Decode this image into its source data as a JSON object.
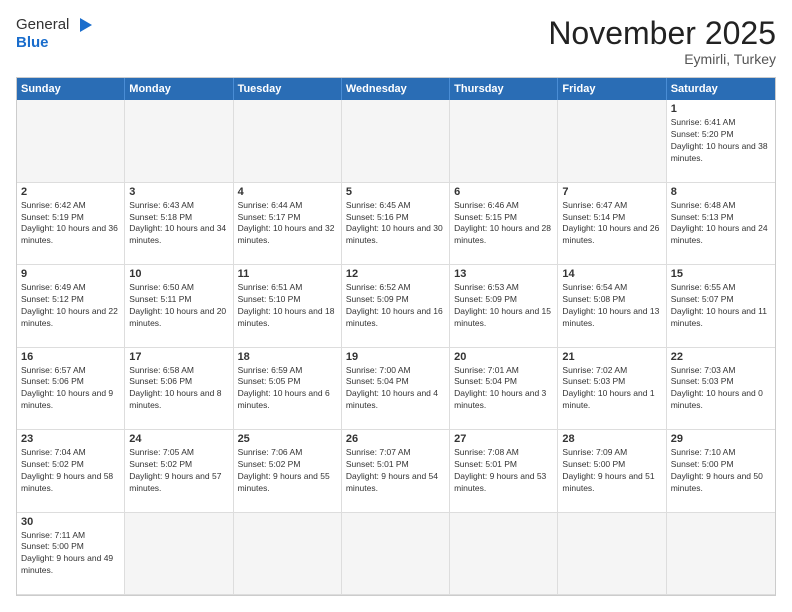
{
  "header": {
    "logo_general": "General",
    "logo_blue": "Blue",
    "month_year": "November 2025",
    "location": "Eymirli, Turkey"
  },
  "days": [
    "Sunday",
    "Monday",
    "Tuesday",
    "Wednesday",
    "Thursday",
    "Friday",
    "Saturday"
  ],
  "cells": [
    {
      "day": "",
      "empty": true,
      "text": ""
    },
    {
      "day": "",
      "empty": true,
      "text": ""
    },
    {
      "day": "",
      "empty": true,
      "text": ""
    },
    {
      "day": "",
      "empty": true,
      "text": ""
    },
    {
      "day": "",
      "empty": true,
      "text": ""
    },
    {
      "day": "",
      "empty": true,
      "text": ""
    },
    {
      "day": "1",
      "text": "Sunrise: 6:41 AM\nSunset: 5:20 PM\nDaylight: 10 hours and 38 minutes."
    },
    {
      "day": "2",
      "text": "Sunrise: 6:42 AM\nSunset: 5:19 PM\nDaylight: 10 hours and 36 minutes."
    },
    {
      "day": "3",
      "text": "Sunrise: 6:43 AM\nSunset: 5:18 PM\nDaylight: 10 hours and 34 minutes."
    },
    {
      "day": "4",
      "text": "Sunrise: 6:44 AM\nSunset: 5:17 PM\nDaylight: 10 hours and 32 minutes."
    },
    {
      "day": "5",
      "text": "Sunrise: 6:45 AM\nSunset: 5:16 PM\nDaylight: 10 hours and 30 minutes."
    },
    {
      "day": "6",
      "text": "Sunrise: 6:46 AM\nSunset: 5:15 PM\nDaylight: 10 hours and 28 minutes."
    },
    {
      "day": "7",
      "text": "Sunrise: 6:47 AM\nSunset: 5:14 PM\nDaylight: 10 hours and 26 minutes."
    },
    {
      "day": "8",
      "text": "Sunrise: 6:48 AM\nSunset: 5:13 PM\nDaylight: 10 hours and 24 minutes."
    },
    {
      "day": "9",
      "text": "Sunrise: 6:49 AM\nSunset: 5:12 PM\nDaylight: 10 hours and 22 minutes."
    },
    {
      "day": "10",
      "text": "Sunrise: 6:50 AM\nSunset: 5:11 PM\nDaylight: 10 hours and 20 minutes."
    },
    {
      "day": "11",
      "text": "Sunrise: 6:51 AM\nSunset: 5:10 PM\nDaylight: 10 hours and 18 minutes."
    },
    {
      "day": "12",
      "text": "Sunrise: 6:52 AM\nSunset: 5:09 PM\nDaylight: 10 hours and 16 minutes."
    },
    {
      "day": "13",
      "text": "Sunrise: 6:53 AM\nSunset: 5:09 PM\nDaylight: 10 hours and 15 minutes."
    },
    {
      "day": "14",
      "text": "Sunrise: 6:54 AM\nSunset: 5:08 PM\nDaylight: 10 hours and 13 minutes."
    },
    {
      "day": "15",
      "text": "Sunrise: 6:55 AM\nSunset: 5:07 PM\nDaylight: 10 hours and 11 minutes."
    },
    {
      "day": "16",
      "text": "Sunrise: 6:57 AM\nSunset: 5:06 PM\nDaylight: 10 hours and 9 minutes."
    },
    {
      "day": "17",
      "text": "Sunrise: 6:58 AM\nSunset: 5:06 PM\nDaylight: 10 hours and 8 minutes."
    },
    {
      "day": "18",
      "text": "Sunrise: 6:59 AM\nSunset: 5:05 PM\nDaylight: 10 hours and 6 minutes."
    },
    {
      "day": "19",
      "text": "Sunrise: 7:00 AM\nSunset: 5:04 PM\nDaylight: 10 hours and 4 minutes."
    },
    {
      "day": "20",
      "text": "Sunrise: 7:01 AM\nSunset: 5:04 PM\nDaylight: 10 hours and 3 minutes."
    },
    {
      "day": "21",
      "text": "Sunrise: 7:02 AM\nSunset: 5:03 PM\nDaylight: 10 hours and 1 minute."
    },
    {
      "day": "22",
      "text": "Sunrise: 7:03 AM\nSunset: 5:03 PM\nDaylight: 10 hours and 0 minutes."
    },
    {
      "day": "23",
      "text": "Sunrise: 7:04 AM\nSunset: 5:02 PM\nDaylight: 9 hours and 58 minutes."
    },
    {
      "day": "24",
      "text": "Sunrise: 7:05 AM\nSunset: 5:02 PM\nDaylight: 9 hours and 57 minutes."
    },
    {
      "day": "25",
      "text": "Sunrise: 7:06 AM\nSunset: 5:02 PM\nDaylight: 9 hours and 55 minutes."
    },
    {
      "day": "26",
      "text": "Sunrise: 7:07 AM\nSunset: 5:01 PM\nDaylight: 9 hours and 54 minutes."
    },
    {
      "day": "27",
      "text": "Sunrise: 7:08 AM\nSunset: 5:01 PM\nDaylight: 9 hours and 53 minutes."
    },
    {
      "day": "28",
      "text": "Sunrise: 7:09 AM\nSunset: 5:00 PM\nDaylight: 9 hours and 51 minutes."
    },
    {
      "day": "29",
      "text": "Sunrise: 7:10 AM\nSunset: 5:00 PM\nDaylight: 9 hours and 50 minutes."
    },
    {
      "day": "30",
      "text": "Sunrise: 7:11 AM\nSunset: 5:00 PM\nDaylight: 9 hours and 49 minutes."
    },
    {
      "day": "",
      "empty": true,
      "text": ""
    },
    {
      "day": "",
      "empty": true,
      "text": ""
    },
    {
      "day": "",
      "empty": true,
      "text": ""
    },
    {
      "day": "",
      "empty": true,
      "text": ""
    },
    {
      "day": "",
      "empty": true,
      "text": ""
    },
    {
      "day": "",
      "empty": true,
      "text": ""
    }
  ]
}
